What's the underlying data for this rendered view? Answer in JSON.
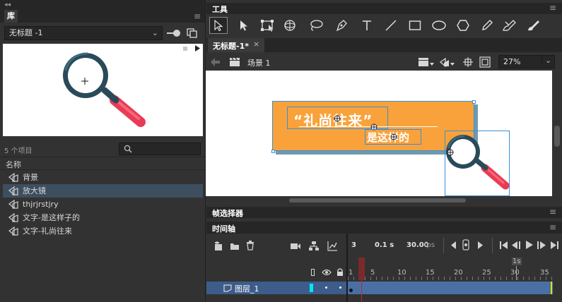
{
  "library": {
    "collapse_glyph": "◂◂",
    "tab": "库",
    "document": "无标题 -1",
    "item_count": "5 个项目",
    "column_name": "名称",
    "items": [
      {
        "label": "背景",
        "icon": "graphic-symbol-icon"
      },
      {
        "label": "放大镜",
        "icon": "graphic-symbol-icon",
        "selected": true
      },
      {
        "label": "thjrjrstjry",
        "icon": "graphic-symbol-icon"
      },
      {
        "label": "文字-是这样子的",
        "icon": "graphic-symbol-icon"
      },
      {
        "label": "文字-礼尚往来",
        "icon": "graphic-symbol-icon"
      }
    ]
  },
  "tools": {
    "tab": "工具",
    "items": [
      "selection-tool",
      "subselection-tool",
      "free-transform-tool",
      "3d-rotation-tool",
      "lasso-tool",
      "pen-tool",
      "text-tool",
      "line-tool",
      "rectangle-tool",
      "oval-tool",
      "polystar-tool",
      "pencil-tool",
      "paint-brush-tool",
      "brush-tool"
    ]
  },
  "document_tab": {
    "label": "无标题-1*",
    "close": "×"
  },
  "editbar": {
    "scene": "场景 1",
    "zoom": "27%"
  },
  "stage": {
    "headline": "“礼尚往来”",
    "subline": "是这样的",
    "banner_color": "#f9a23c"
  },
  "frame_picker": {
    "tab": "帧选择器"
  },
  "timeline": {
    "tab": "时间轴",
    "frame": "3",
    "time": "0.1 s",
    "fps_value": "30.00",
    "fps_unit": "fps",
    "seconds_marker": "1s",
    "ruler": [
      "1",
      "5",
      "10",
      "15",
      "20",
      "25",
      "30",
      "35"
    ],
    "layer": "图层_1",
    "layer_color": "#00e5ff"
  },
  "colors": {
    "panel": "#323232",
    "selection": "#3d4e5f",
    "playhead": "#9b2b2b",
    "frames": "#4a6fa5"
  }
}
